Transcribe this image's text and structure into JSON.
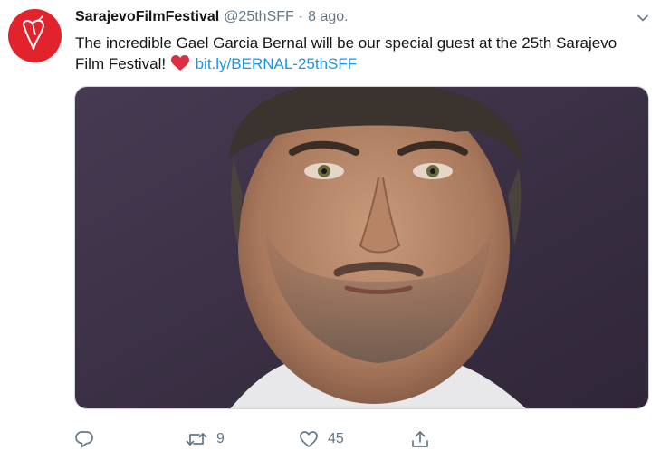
{
  "colors": {
    "brand": "#e3232c",
    "link": "#1b95e0",
    "secondary_text": "#657786",
    "heart_emoji": "#dd2e44"
  },
  "tweet": {
    "avatar_icon": "heart-logo-icon",
    "display_name": "SarajevoFilmFestival",
    "handle": "@25thSFF",
    "separator": "·",
    "timestamp": "8 ago.",
    "menu_icon": "chevron-down-icon",
    "text_part1": "The incredible Gael Garcia Bernal will be our special guest at the 25th Sarajevo Film Festival!",
    "emoji_icon": "red-heart-icon",
    "link": "bit.ly/BERNAL-25thSFF",
    "media_description_icon": "portrait-photo"
  },
  "actions": {
    "reply": {
      "icon": "reply-icon",
      "count": ""
    },
    "retweet": {
      "icon": "retweet-icon",
      "count": "9"
    },
    "like": {
      "icon": "like-icon",
      "count": "45"
    },
    "share": {
      "icon": "share-icon",
      "count": ""
    }
  }
}
